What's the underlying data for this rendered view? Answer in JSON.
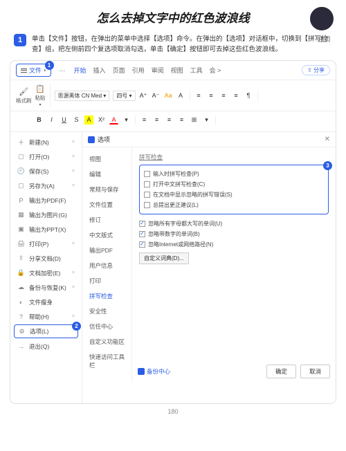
{
  "header": {
    "title": "怎么去掉文字中的红色波浪线",
    "homepage": "主页"
  },
  "step": {
    "num": "1",
    "text": "单击【文件】按钮，在弹出的菜单中选择【选项】命令。在弹出的【选项】对话框中，切换到【拼写检查】组，把左侧前四个复选项取消勾选，单击【确定】按钮即可去掉这些红色波浪线。"
  },
  "tabs": {
    "file": "文件",
    "dots": "···",
    "items": [
      "开始",
      "插入",
      "页面",
      "引用",
      "审阅",
      "视图",
      "工具",
      "会 >"
    ],
    "share": "⇪ 分享"
  },
  "toolbar": {
    "brush": "格式刷",
    "paste": "粘贴",
    "font": "思源黑体 CN Med",
    "size": "四号"
  },
  "badges": {
    "b1": "1",
    "b2": "2",
    "b3": "3"
  },
  "filemenu": [
    {
      "icon": "＋",
      "label": "新建(N)",
      "arrow": ">"
    },
    {
      "icon": "▢",
      "label": "打开(O)",
      "arrow": ">"
    },
    {
      "icon": "🕘",
      "label": "保存(S)",
      "arrow": ">"
    },
    {
      "icon": "▢",
      "label": "另存为(A)",
      "arrow": ">"
    },
    {
      "icon": "P",
      "label": "输出为PDF(F)"
    },
    {
      "icon": "▦",
      "label": "输出为图片(G)"
    },
    {
      "icon": "▣",
      "label": "输出为PPT(X)"
    },
    {
      "icon": "🖨",
      "label": "打印(P)",
      "arrow": ">"
    },
    {
      "icon": "⇪",
      "label": "分享文档(D)"
    },
    {
      "icon": "🔒",
      "label": "文档加密(E)",
      "arrow": ">"
    },
    {
      "icon": "☁",
      "label": "备份与恢复(K)",
      "arrow": ">"
    },
    {
      "icon": "◐",
      "label": "文件瘦身"
    },
    {
      "icon": "?",
      "label": "帮助(H)",
      "arrow": ">"
    },
    {
      "icon": "⚙",
      "label": "选项(L)",
      "sel": true
    },
    {
      "icon": "→",
      "label": "退出(Q)"
    }
  ],
  "dialog": {
    "title": "选项",
    "nav": [
      "视图",
      "编辑",
      "常规与保存",
      "文件位置",
      "修订",
      "中文版式",
      "输出PDF",
      "用户信息",
      "打印",
      "拼写检查",
      "安全性",
      "信任中心",
      "自定义功能区",
      "快速访问工具栏"
    ],
    "section": "拼写检查",
    "group1": [
      {
        "label": "输入时拼写检查(P)",
        "checked": false
      },
      {
        "label": "打开中文拼写检查(C)",
        "checked": false
      },
      {
        "label": "在文档中显示忽略的拼写错误(S)",
        "checked": false
      },
      {
        "label": "总提出更正建议(L)",
        "checked": false
      }
    ],
    "group2": [
      {
        "label": "忽略所有字母都大写的单词(U)",
        "checked": true
      },
      {
        "label": "忽略带数字的单词(B)",
        "checked": true
      },
      {
        "label": "忽略Internet或网络路径(N)",
        "checked": true
      }
    ],
    "customDict": "自定义词典(D)...",
    "backup": "备份中心",
    "ok": "确定",
    "cancel": "取消"
  },
  "pageNum": "180"
}
